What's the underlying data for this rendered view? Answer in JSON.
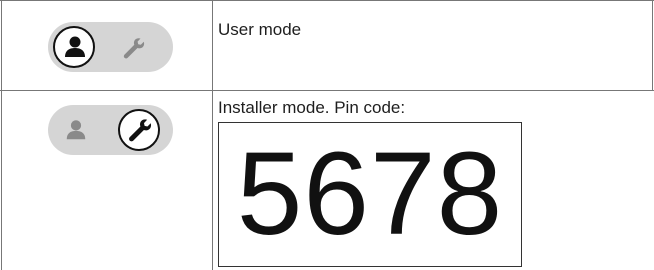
{
  "rows": [
    {
      "mode_label": "User mode",
      "toggle": {
        "active": "user",
        "icons": [
          "person-icon",
          "wrench-icon"
        ]
      }
    },
    {
      "mode_label": "Installer mode. Pin code:",
      "toggle": {
        "active": "installer",
        "icons": [
          "person-icon",
          "wrench-icon"
        ]
      },
      "pin_code": "5678"
    }
  ],
  "colors": {
    "toggle_track": "#d5d5d5",
    "inactive_icon": "#8a8a8a",
    "active_icon": "#111111",
    "border": "#777777"
  }
}
